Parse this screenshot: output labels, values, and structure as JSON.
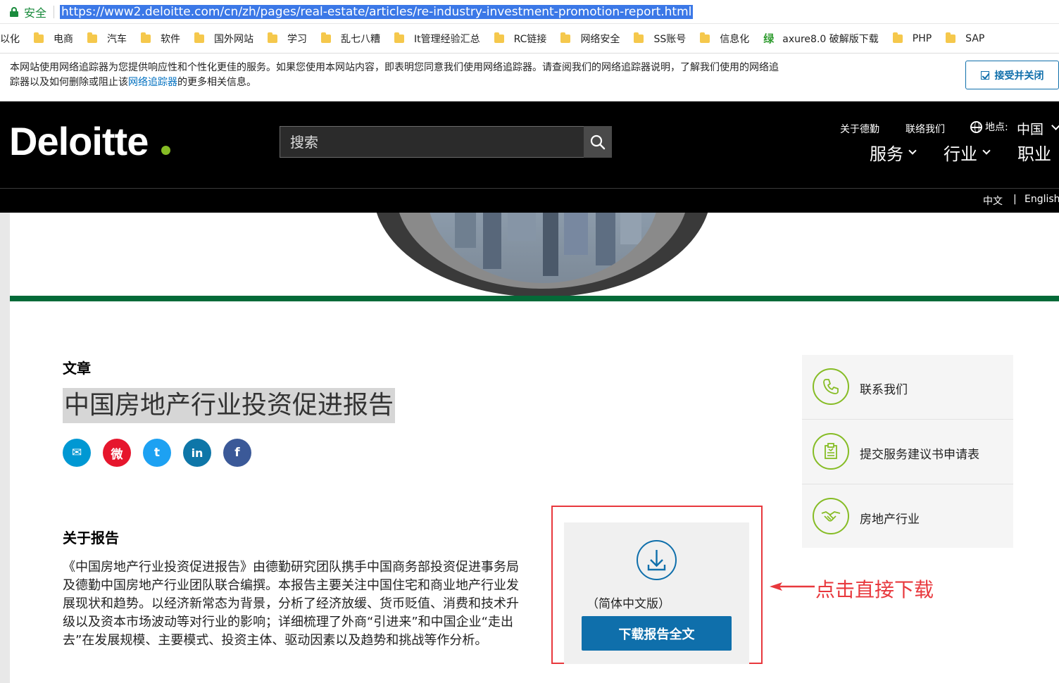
{
  "browser": {
    "secure_label": "安全",
    "url": "https://www2.deloitte.com/cn/zh/pages/real-estate/articles/re-industry-investment-promotion-report.html",
    "bookmarks": [
      {
        "label": "以化",
        "icon": "none"
      },
      {
        "label": "电商",
        "icon": "folder-icon"
      },
      {
        "label": "汽车",
        "icon": "folder-icon"
      },
      {
        "label": "软件",
        "icon": "folder-icon"
      },
      {
        "label": "国外网站",
        "icon": "folder-icon"
      },
      {
        "label": "学习",
        "icon": "folder-icon"
      },
      {
        "label": "乱七八糟",
        "icon": "folder-icon"
      },
      {
        "label": "It管理经验汇总",
        "icon": "folder-icon"
      },
      {
        "label": "RC链接",
        "icon": "folder-icon"
      },
      {
        "label": "网络安全",
        "icon": "folder-icon"
      },
      {
        "label": "SS账号",
        "icon": "folder-icon"
      },
      {
        "label": "信息化",
        "icon": "folder-icon"
      },
      {
        "label": "axure8.0 破解版下载",
        "icon": "green-glyph",
        "glyph": "绿"
      },
      {
        "label": "PHP",
        "icon": "folder-icon"
      },
      {
        "label": "SAP",
        "icon": "folder-icon"
      }
    ]
  },
  "cookie_banner": {
    "text_part1": "本网站使用网络追踪器为您提供响应性和个性化更佳的服务。如果您使用本网站内容，即表明您同意我们使用网络追踪器。请查阅我们的网络追踪器说明，了解我们使用的网络追",
    "text_part2": "踪器以及如何删除或阻止该",
    "link": "网络追踪器",
    "text_part3": "的更多相关信息。",
    "accept_label": "接受并关闭"
  },
  "header": {
    "logo": "Deloitte",
    "search_placeholder": "搜索",
    "top_links": [
      "关于德勤",
      "联络我们"
    ],
    "location_label": "地点:",
    "location_value": "中国",
    "main_nav": [
      "服务",
      "行业",
      "职业"
    ],
    "languages": [
      "中文",
      "English"
    ],
    "lang_separator": "|"
  },
  "article": {
    "kicker": "文章",
    "title": "中国房地产行业投资促进报告",
    "social": [
      {
        "name": "email",
        "glyph": "✉",
        "color": "#0098d3"
      },
      {
        "name": "weibo",
        "glyph": "微",
        "color": "#e6162d"
      },
      {
        "name": "twitter",
        "glyph": "t",
        "color": "#1da1f2"
      },
      {
        "name": "linkedin",
        "glyph": "in",
        "color": "#0e76a8"
      },
      {
        "name": "facebook",
        "glyph": "f",
        "color": "#3b5998"
      }
    ],
    "about_heading": "关于报告",
    "body": "《中国房地产行业投资促进报告》由德勤研究团队携手中国商务部投资促进事务局及德勤中国房地产行业团队联合编撰。本报告主要关注中国住宅和商业地产行业发展现状和趋势。以经济新常态为背景，分析了经济放缓、货币贬值、消费和技术升级以及资本市场波动等对行业的影响；详细梳理了外商“引进来”和中国企业“走出去”在发展规模、主要模式、投资主体、驱动因素以及趋势和挑战等作分析。"
  },
  "download": {
    "edition": "（简体中文版）",
    "button": "下载报告全文"
  },
  "annotation": {
    "text": "点击直接下载",
    "color": "#e8383d"
  },
  "sidebar": {
    "items": [
      {
        "label": "联系我们",
        "icon": "phone-icon"
      },
      {
        "label": "提交服务建议书申请表",
        "icon": "form-icon"
      },
      {
        "label": "房地产行业",
        "icon": "handshake-icon"
      }
    ]
  }
}
